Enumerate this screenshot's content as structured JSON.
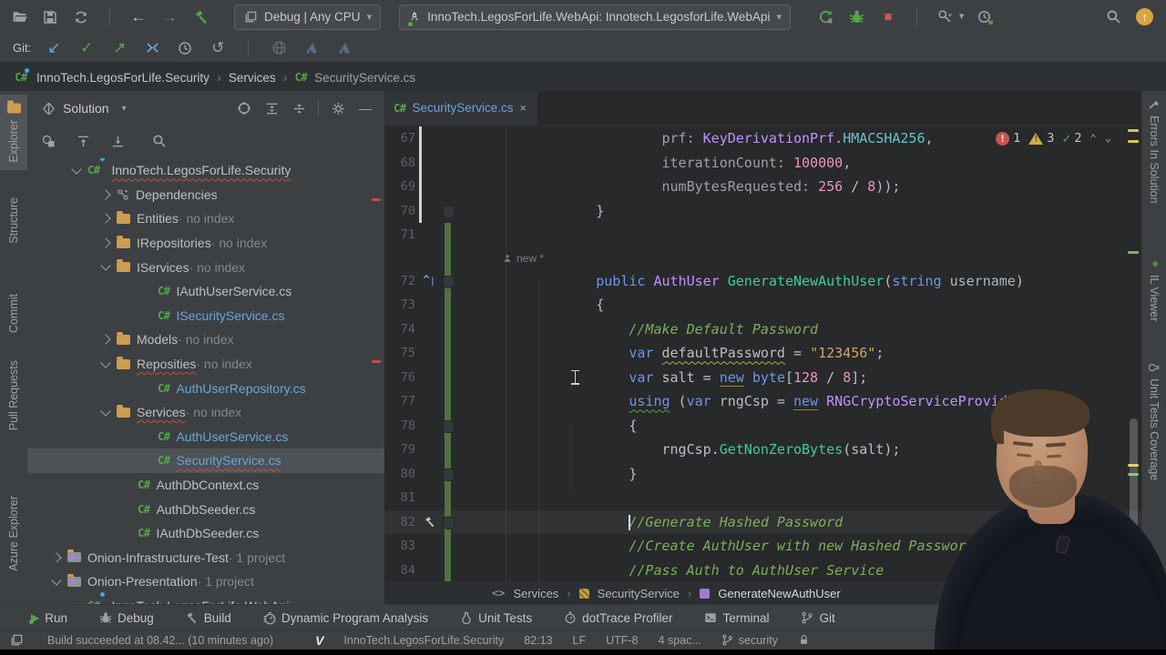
{
  "toolbar": {
    "debug_config": "Debug | Any CPU",
    "run_config": "InnoTech.LegosForLife.WebApi: Innotech.LegosforLife.WebApi"
  },
  "git_bar": {
    "label": "Git:"
  },
  "navbar": {
    "project": "InnoTech.LegosForLife.Security",
    "folder": "Services",
    "file": "SecurityService.cs",
    "cs_badge": "C#"
  },
  "left_stripe": {
    "items": [
      {
        "label": "Explorer"
      },
      {
        "label": "Structure"
      },
      {
        "label": "Commit"
      },
      {
        "label": "Pull Requests"
      },
      {
        "label": "Azure Explorer"
      }
    ]
  },
  "right_stripe": {
    "items": [
      {
        "label": "Errors In Solution"
      },
      {
        "label": "IL Viewer"
      },
      {
        "label": "Unit Tests Coverage"
      }
    ]
  },
  "solution_panel": {
    "title": "Solution",
    "tree": [
      {
        "indent": 50,
        "chev": "v",
        "icon": "proj",
        "label": "InnoTech.LegosForLife.Security",
        "wavy": true
      },
      {
        "indent": 82,
        "chev": "r",
        "icon": "dep",
        "label": "Dependencies"
      },
      {
        "indent": 82,
        "chev": "r",
        "icon": "folder",
        "label": "Entities",
        "suffix": " · no index"
      },
      {
        "indent": 82,
        "chev": "r",
        "icon": "folder",
        "label": "IRepositories",
        "suffix": " · no index"
      },
      {
        "indent": 82,
        "chev": "v",
        "icon": "folder",
        "label": "IServices",
        "suffix": " · no index"
      },
      {
        "indent": 126,
        "icon": "cs",
        "label": "IAuthUserService.cs"
      },
      {
        "indent": 126,
        "icon": "cs",
        "label": "ISecurityService.cs",
        "cls": "t-blue"
      },
      {
        "indent": 82,
        "chev": "r",
        "icon": "folder",
        "label": "Models",
        "suffix": " · no index"
      },
      {
        "indent": 82,
        "chev": "v",
        "icon": "folder",
        "label": "Reposities",
        "suffix": " · no index",
        "wavy": true
      },
      {
        "indent": 126,
        "icon": "cs",
        "label": "AuthUserRepository.cs",
        "cls": "t-blue"
      },
      {
        "indent": 82,
        "chev": "v",
        "icon": "folder",
        "label": "Services",
        "suffix": " · no index",
        "wavy": true
      },
      {
        "indent": 126,
        "icon": "cs",
        "label": "AuthUserService.cs",
        "cls": "t-blue"
      },
      {
        "indent": 126,
        "icon": "cs",
        "label": "SecurityService.cs",
        "cls": "t-blue",
        "selected": true,
        "wavy": true
      },
      {
        "indent": 104,
        "icon": "cs",
        "label": "AuthDbContext.cs"
      },
      {
        "indent": 104,
        "icon": "cs",
        "label": "AuthDbSeeder.cs"
      },
      {
        "indent": 104,
        "icon": "cs",
        "label": "IAuthDbSeeder.cs"
      },
      {
        "indent": 28,
        "chev": "r",
        "icon": "slnf",
        "label": "Onion-Infrastructure-Test",
        "suffix": " · 1 project"
      },
      {
        "indent": 28,
        "chev": "v",
        "icon": "slnf",
        "label": "Onion-Presentation",
        "suffix": " · 1 project"
      },
      {
        "indent": 50,
        "chev": "v",
        "icon": "proj",
        "label": "InnoTech.LegosForLife.WebApi"
      }
    ]
  },
  "editor": {
    "tab": {
      "label": "SecurityService.cs",
      "badge": "C#",
      "close": "×"
    },
    "inspections": {
      "errors": "1",
      "warnings": "3",
      "ok": "2"
    },
    "vcs_inlay": "new *",
    "breadcrumb": [
      {
        "label": "Services",
        "icon": "namespace"
      },
      {
        "label": "SecurityService",
        "icon": "class"
      },
      {
        "label": "GenerateNewAuthUser",
        "icon": "method"
      }
    ],
    "lines": [
      {
        "n": "67",
        "bar": "c",
        "seg": [
          [
            "sp",
            "                "
          ],
          [
            "pm",
            "prf: "
          ],
          [
            "ty",
            "KeyDerivationPrf"
          ],
          [
            "d",
            "."
          ],
          [
            "cons",
            "HMACSHA256"
          ],
          [
            "d",
            ","
          ]
        ]
      },
      {
        "n": "68",
        "bar": "c",
        "seg": [
          [
            "sp",
            "                "
          ],
          [
            "pm",
            "iterationCount: "
          ],
          [
            "num2",
            "100000"
          ],
          [
            "d",
            ","
          ]
        ]
      },
      {
        "n": "69",
        "bar": "c",
        "seg": [
          [
            "sp",
            "                "
          ],
          [
            "pm",
            "numBytesRequested: "
          ],
          [
            "num2",
            "256"
          ],
          [
            "d",
            " / "
          ],
          [
            "num2",
            "8"
          ],
          [
            "d",
            "));"
          ]
        ]
      },
      {
        "n": "70",
        "bar": "c",
        "pin": true,
        "seg": [
          [
            "sp",
            "        "
          ],
          [
            "d",
            "}"
          ]
        ]
      },
      {
        "n": "71",
        "bar": "g",
        "seg": []
      },
      {
        "inlay": true,
        "text": "new *"
      },
      {
        "n": "72",
        "bar": "g",
        "pin": true,
        "gut": "impl",
        "seg": [
          [
            "sp",
            "        "
          ],
          [
            "kw",
            "public "
          ],
          [
            "ty",
            "AuthUser "
          ],
          [
            "mth",
            "GenerateNewAuthUser"
          ],
          [
            "d",
            "("
          ],
          [
            "kw",
            "string "
          ],
          [
            "pr",
            "username"
          ],
          [
            "d",
            ")"
          ]
        ]
      },
      {
        "n": "73",
        "bar": "g",
        "seg": [
          [
            "sp",
            "        "
          ],
          [
            "d",
            "{"
          ]
        ]
      },
      {
        "n": "74",
        "bar": "g",
        "seg": [
          [
            "sp",
            "            "
          ],
          [
            "com",
            "//Make Default Password"
          ]
        ]
      },
      {
        "n": "75",
        "bar": "g",
        "seg": [
          [
            "sp",
            "            "
          ],
          [
            "kw",
            "var "
          ],
          [
            "wid",
            "defaultPassword"
          ],
          [
            "d",
            " = "
          ],
          [
            "str",
            "\"123456\""
          ],
          [
            "d",
            ";"
          ]
        ]
      },
      {
        "n": "76",
        "bar": "g",
        "ibeam": true,
        "seg": [
          [
            "sp",
            "            "
          ],
          [
            "kw",
            "var "
          ],
          [
            "d",
            "salt = "
          ],
          [
            "kwu",
            "new"
          ],
          [
            "d",
            " "
          ],
          [
            "kw",
            "byte"
          ],
          [
            "d",
            "["
          ],
          [
            "num2",
            "128"
          ],
          [
            "d",
            " / "
          ],
          [
            "num2",
            "8"
          ],
          [
            "d",
            "];"
          ]
        ]
      },
      {
        "n": "77",
        "bar": "g",
        "seg": [
          [
            "sp",
            "            "
          ],
          [
            "kwg",
            "using"
          ],
          [
            "d",
            " ("
          ],
          [
            "kw",
            "var"
          ],
          [
            "d",
            " rngCsp = "
          ],
          [
            "kwu",
            "new"
          ],
          [
            "d",
            " "
          ],
          [
            "ty",
            "RNGCryptoServiceProvider"
          ],
          [
            "d",
            "())"
          ]
        ]
      },
      {
        "n": "78",
        "bar": "g",
        "pin": true,
        "seg": [
          [
            "sp",
            "            "
          ],
          [
            "d",
            "{"
          ]
        ]
      },
      {
        "n": "79",
        "bar": "g",
        "seg": [
          [
            "sp",
            "                "
          ],
          [
            "d",
            "rngCsp."
          ],
          [
            "mth",
            "GetNonZeroBytes"
          ],
          [
            "d",
            "(salt);"
          ]
        ]
      },
      {
        "n": "80",
        "bar": "g",
        "pin": true,
        "seg": [
          [
            "sp",
            "            "
          ],
          [
            "d",
            "}"
          ]
        ]
      },
      {
        "n": "81",
        "bar": "g",
        "seg": []
      },
      {
        "n": "82",
        "bar": "g",
        "pin": true,
        "gut": "hammer",
        "cur": true,
        "caret": true,
        "seg": [
          [
            "sp",
            "            "
          ],
          [
            "com",
            "//Generate Hashed Password"
          ]
        ]
      },
      {
        "n": "83",
        "bar": "g",
        "seg": [
          [
            "sp",
            "            "
          ],
          [
            "com",
            "//Create AuthUser with new Hashed Password"
          ]
        ]
      },
      {
        "n": "84",
        "bar": "g",
        "seg": [
          [
            "sp",
            "            "
          ],
          [
            "com",
            "//Pass Auth to AuthUser Service"
          ]
        ]
      }
    ]
  },
  "bottom_bar": {
    "run": "Run",
    "debug": "Debug",
    "build": "Build",
    "dpa": "Dynamic Program Analysis",
    "unit_tests": "Unit Tests",
    "dottrace": "dotTrace Profiler",
    "terminal": "Terminal",
    "git": "Git"
  },
  "status_bar": {
    "build_message": "Build succeeded at 08.42... (10 minutes ago)",
    "project": "InnoTech.LegosForLife.Security",
    "caret_position": "82:13",
    "line_separator": "LF",
    "encoding": "UTF-8",
    "indent_style": "4 spac...",
    "branch": "security"
  }
}
